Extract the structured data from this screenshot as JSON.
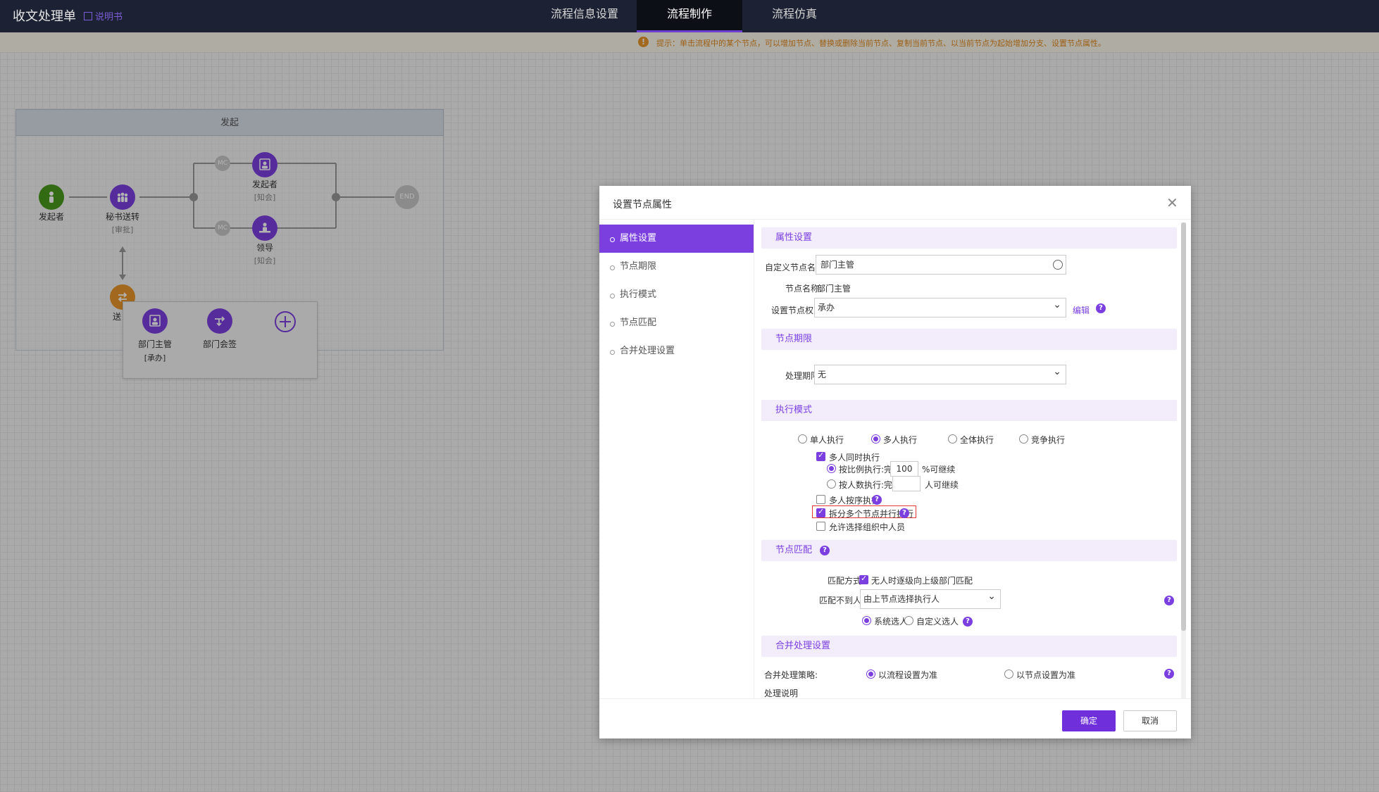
{
  "app": {
    "title": "收文处理单",
    "manual_link": "说明书"
  },
  "nav": {
    "tabs": [
      {
        "label": "流程信息设置",
        "active": false
      },
      {
        "label": "流程制作",
        "active": true
      },
      {
        "label": "流程仿真",
        "active": false
      }
    ]
  },
  "hint": {
    "icon": "info-icon",
    "text": "提示：单击流程中的某个节点，可以增加节点、替换或删除当前节点、复制当前节点、以当前节点为起始增加分支、设置节点属性。"
  },
  "flow": {
    "lane_title": "发起",
    "nodes": {
      "start": {
        "label": "发起者",
        "color": "#4a9a1e"
      },
      "secretary": {
        "label": "秘书送转",
        "sub": "[审批]",
        "color": "#7b3fe0"
      },
      "initiator": {
        "label": "发起者",
        "sub": "[知会]",
        "color": "#7b3fe0"
      },
      "leader": {
        "label": "领导",
        "sub": "[知会]",
        "color": "#7b3fe0"
      },
      "transfer": {
        "label": "送",
        "color": "#e8962b"
      },
      "mc_top": "MC",
      "mc_bottom": "MC",
      "end": "END"
    },
    "popup": {
      "items": [
        {
          "label": "部门主管",
          "sub": "[承办]"
        },
        {
          "label": "部门会签"
        }
      ]
    }
  },
  "dialog": {
    "title": "设置节点属性",
    "sidebar": [
      {
        "label": "属性设置",
        "active": true
      },
      {
        "label": "节点期限",
        "active": false
      },
      {
        "label": "执行模式",
        "active": false
      },
      {
        "label": "节点匹配",
        "active": false
      },
      {
        "label": "合并处理设置",
        "active": false
      }
    ],
    "attr": {
      "heading": "属性设置",
      "custom_name_label": "自定义节点名称:",
      "custom_name_value": "部门主管",
      "node_name_label": "节点名称:",
      "node_name_value": "部门主管",
      "permission_label": "设置节点权限:",
      "permission_value": "承办",
      "edit_link": "编辑"
    },
    "deadline": {
      "heading": "节点期限",
      "label": "处理期限:",
      "value": "无"
    },
    "exec": {
      "heading": "执行模式",
      "modes": [
        "单人执行",
        "多人执行",
        "全体执行",
        "竞争执行"
      ],
      "selected_mode": "多人执行",
      "simultaneous": "多人同时执行",
      "by_ratio": "按比例执行:完成",
      "ratio_value": "100",
      "ratio_suffix": "%可继续",
      "by_count": "按人数执行:完成",
      "count_value": "",
      "count_suffix": "人可继续",
      "sequential": "多人按序执行",
      "split_parallel": "拆分多个节点并行执行",
      "allow_org": "允许选择组织中人员"
    },
    "match": {
      "heading": "节点匹配",
      "method_label": "匹配方式:",
      "method_value": "无人时逐级向上级部门匹配",
      "not_found_label": "匹配不到人:",
      "not_found_value": "由上节点选择执行人",
      "system_pick": "系统选人",
      "custom_pick": "自定义选人"
    },
    "merge": {
      "heading": "合并处理设置",
      "strategy_label": "合并处理策略:",
      "by_flow": "以流程设置为准",
      "by_node": "以节点设置为准",
      "desc_label": "处理说明"
    },
    "buttons": {
      "ok": "确定",
      "cancel": "取消"
    }
  }
}
